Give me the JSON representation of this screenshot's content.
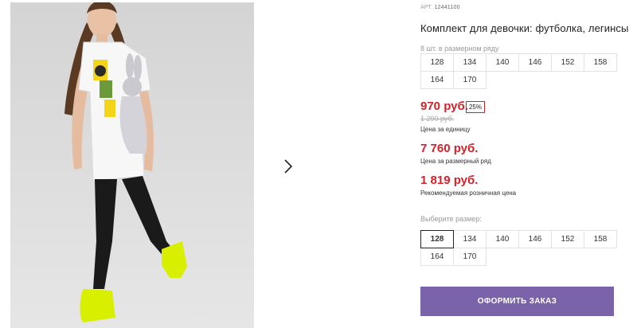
{
  "product": {
    "art_label": "АРТ.",
    "art_number": "12441100",
    "title": "Комплект для девочки: футболка, легинсы",
    "pack_info": "8 шт. в размерном ряду",
    "pack_sizes": [
      "128",
      "134",
      "140",
      "146",
      "152",
      "158",
      "164",
      "170"
    ]
  },
  "pricing": {
    "unit_price": "970 руб.",
    "discount_badge": "25%",
    "old_price": "1 290 руб.",
    "unit_label": "Цена за единицу",
    "row_price": "7 760 руб.",
    "row_label": "Цена за размерный ряд",
    "recommended_price": "1 819 руб.",
    "recommended_label": "Рекомендуемая розничная цена"
  },
  "size_picker": {
    "label": "Выберите размер:",
    "options": [
      "128",
      "134",
      "140",
      "146",
      "152",
      "158",
      "164",
      "170"
    ],
    "selected": "128"
  },
  "actions": {
    "order_label": "ОФОРМИТЬ ЗАКАЗ"
  },
  "gallery": {
    "next_icon": "chevron-right-icon"
  },
  "colors": {
    "price_red": "#d6202a",
    "button_purple": "#7a63a8"
  }
}
